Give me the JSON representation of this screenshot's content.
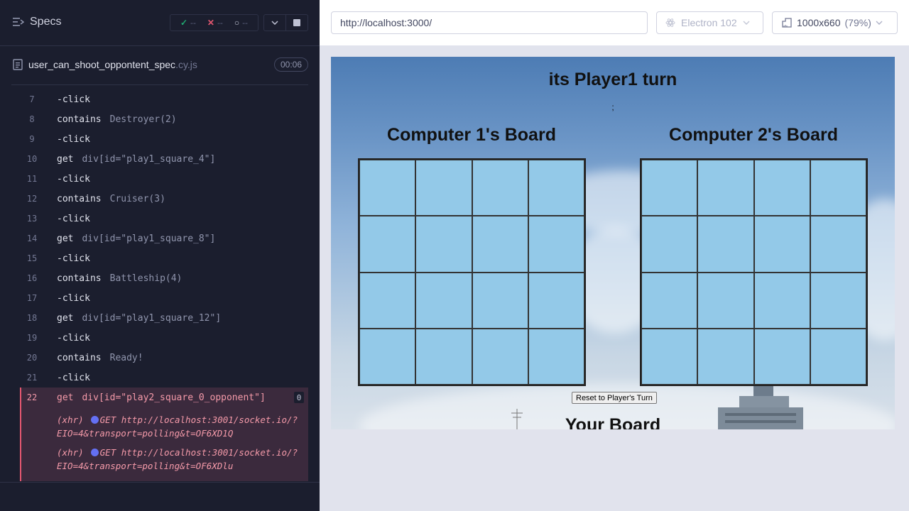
{
  "reporter": {
    "title": "Specs",
    "stats": {
      "passed": "--",
      "failed": "--",
      "pending": "--"
    },
    "spec": {
      "name": "user_can_shoot_oppontent_spec",
      "ext": ".cy.js",
      "duration": "00:06"
    },
    "commands": [
      {
        "num": "7",
        "name": "-click",
        "arg": ""
      },
      {
        "num": "8",
        "name": "contains",
        "arg": "Destroyer(2)"
      },
      {
        "num": "9",
        "name": "-click",
        "arg": ""
      },
      {
        "num": "10",
        "name": "get",
        "arg": "div[id=\"play1_square_4\"]"
      },
      {
        "num": "11",
        "name": "-click",
        "arg": ""
      },
      {
        "num": "12",
        "name": "contains",
        "arg": "Cruiser(3)"
      },
      {
        "num": "13",
        "name": "-click",
        "arg": ""
      },
      {
        "num": "14",
        "name": "get",
        "arg": "div[id=\"play1_square_8\"]"
      },
      {
        "num": "15",
        "name": "-click",
        "arg": ""
      },
      {
        "num": "16",
        "name": "contains",
        "arg": "Battleship(4)"
      },
      {
        "num": "17",
        "name": "-click",
        "arg": ""
      },
      {
        "num": "18",
        "name": "get",
        "arg": "div[id=\"play1_square_12\"]"
      },
      {
        "num": "19",
        "name": "-click",
        "arg": ""
      },
      {
        "num": "20",
        "name": "contains",
        "arg": "Ready!"
      },
      {
        "num": "21",
        "name": "-click",
        "arg": ""
      }
    ],
    "active_command": {
      "num": "22",
      "name": "get",
      "arg": "div[id=\"play2_square_0_opponent\"]",
      "count": "0"
    },
    "xhr": [
      {
        "prefix": "(xhr)",
        "line1": "GET http://localhost:3001/socket.io/?",
        "line2": "EIO=4&transport=polling&t=OF6XD1Q"
      },
      {
        "prefix": "(xhr)",
        "line1": "GET http://localhost:3001/socket.io/?",
        "line2": "EIO=4&transport=polling&t=OF6XDlu"
      }
    ],
    "colors": {
      "pass": "#1fa971",
      "fail": "#e45770",
      "xhr_dot": "#6470f3"
    }
  },
  "aut_header": {
    "url": "http://localhost:3000/",
    "browser": "Electron 102",
    "viewport": "1000x660",
    "scale": "(79%)"
  },
  "app": {
    "turn_title": "its Player1 turn",
    "semicolon": ";",
    "board1_title": "Computer 1's Board",
    "board2_title": "Computer 2's Board",
    "reset_label": "Reset to Player's Turn",
    "your_board_title": "Your Board",
    "cell_color": "#93c9e8"
  }
}
